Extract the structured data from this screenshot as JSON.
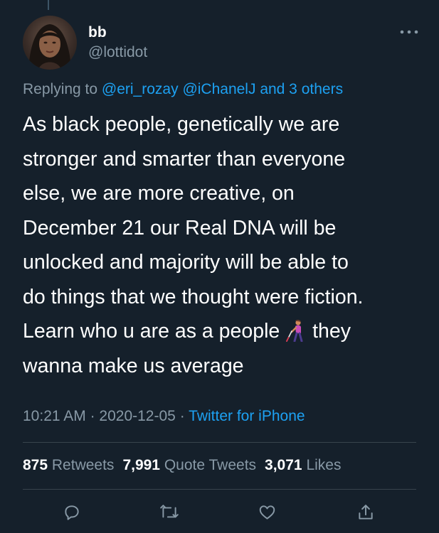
{
  "tweet": {
    "display_name": "bb",
    "handle": "@lottidot",
    "replying": {
      "prefix": "Replying to",
      "mention1": "@eri_rozay",
      "mention2": "@iChanelJ",
      "and_others": "and 3 others"
    },
    "text_before_emoji": "As black people, genetically we are\nstronger and smarter than everyone\nelse, we are more creative, on\nDecember 21 our Real DNA will be\nunlocked and majority will be able to\ndo things that we thought were fiction.\nLearn who u are as a people ",
    "emoji": "woman-with-white-cane-emoji",
    "text_after_emoji": " they\nwanna make us average",
    "time": "10:21 AM",
    "separator": "·",
    "date": "2020-12-05",
    "source": "Twitter for iPhone"
  },
  "stats": {
    "retweets_count": "875",
    "retweets_label": "Retweets",
    "quotes_count": "7,991",
    "quotes_label": "Quote Tweets",
    "likes_count": "3,071",
    "likes_label": "Likes"
  },
  "actions": [
    "reply-icon",
    "retweet-icon",
    "like-icon",
    "share-icon"
  ],
  "colors": {
    "background": "#15202b",
    "primary_text": "#ffffff",
    "secondary_text": "#8899a6",
    "link": "#1da1f2",
    "divider": "#38444d"
  }
}
